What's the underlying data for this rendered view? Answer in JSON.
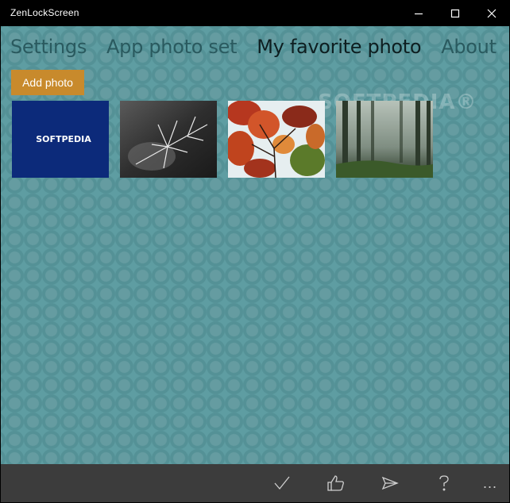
{
  "window": {
    "title": "ZenLockScreen"
  },
  "tabs": [
    {
      "label": "Settings",
      "active": false
    },
    {
      "label": "App photo set",
      "active": false
    },
    {
      "label": "My favorite photo",
      "active": true
    },
    {
      "label": "About",
      "active": false
    }
  ],
  "add_photo_label": "Add photo",
  "watermark": "SOFTPEDIA®",
  "thumbnails": [
    {
      "name": "softpedia-logo",
      "text": "SOFTPEDIA"
    },
    {
      "name": "frost-thorns",
      "text": ""
    },
    {
      "name": "autumn-leaves",
      "text": ""
    },
    {
      "name": "misty-forest",
      "text": ""
    }
  ],
  "bottom_bar": {
    "more_label": "..."
  },
  "colors": {
    "accent": "#c88a2c",
    "background": "#5e9da2",
    "bottom_bar": "#3c3c3c"
  },
  "icons": [
    "minimize-icon",
    "maximize-icon",
    "close-icon",
    "checkmark-icon",
    "thumbs-up-icon",
    "send-icon",
    "help-icon",
    "more-icon"
  ]
}
